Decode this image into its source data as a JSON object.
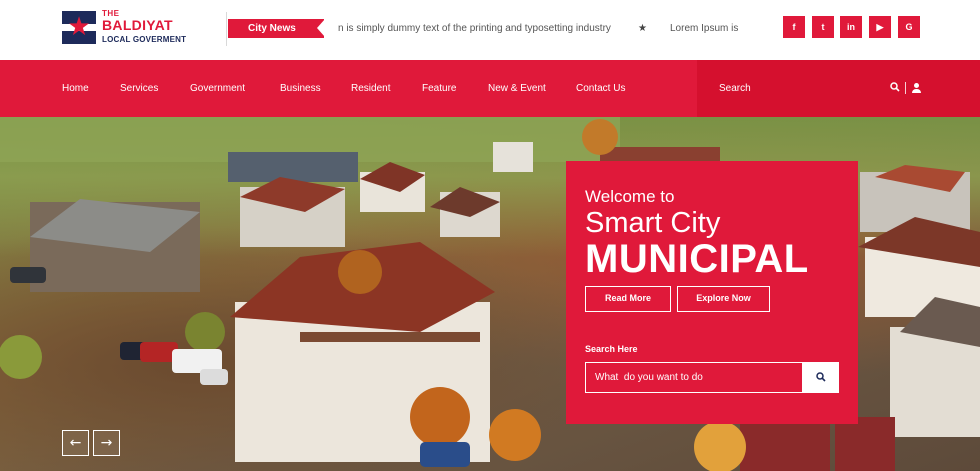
{
  "brand": {
    "the": "THE",
    "name": "BALDIYAT",
    "sub": "LOCAL GOVERMENT",
    "primary_color": "#e0193a",
    "navy_color": "#1d2a5a"
  },
  "news": {
    "label": "City News",
    "ticker_1": "n is simply dummy text of the printing and typosetting industry",
    "ticker_separator": "★",
    "ticker_2": "Lorem Ipsum is"
  },
  "socials": [
    {
      "icon": "facebook-icon",
      "glyph": "f"
    },
    {
      "icon": "twitter-icon",
      "glyph": "t"
    },
    {
      "icon": "linkedin-icon",
      "glyph": "in"
    },
    {
      "icon": "youtube-icon",
      "glyph": "▶"
    },
    {
      "icon": "google-icon",
      "glyph": "G"
    }
  ],
  "nav": {
    "items": [
      "Home",
      "Services",
      "Government",
      "Business",
      "Resident",
      "Feature",
      "New & Event",
      "Contact Us"
    ],
    "search_label": "Search",
    "search_icon": "search-icon",
    "user_icon": "user-icon"
  },
  "hero": {
    "prev_glyph": "←",
    "next_glyph": "→",
    "welcome": "Welcome to",
    "title_line1": "Smart City",
    "title_line2": "MUNICIPAL",
    "read_more": "Read More",
    "explore_now": "Explore Now",
    "search_here": "Search Here",
    "search_placeholder": "What  do you want to do",
    "search_glyph": "⌕"
  }
}
